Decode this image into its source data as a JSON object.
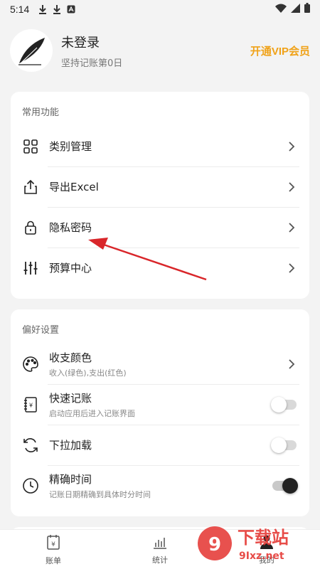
{
  "status_bar": {
    "time": "5:14"
  },
  "profile": {
    "name": "未登录",
    "subtitle": "坚持记账第0日",
    "vip_label": "开通VIP会员"
  },
  "common": {
    "title": "常用功能",
    "items": [
      {
        "label": "类别管理",
        "icon": "grid-icon"
      },
      {
        "label": "导出Excel",
        "icon": "share-icon"
      },
      {
        "label": "隐私密码",
        "icon": "lock-icon"
      },
      {
        "label": "预算中心",
        "icon": "sliders-icon"
      }
    ]
  },
  "prefs": {
    "title": "偏好设置",
    "items": [
      {
        "label": "收支颜色",
        "desc": "收入(绿色),支出(红色)",
        "control": "chevron"
      },
      {
        "label": "快速记账",
        "desc": "启动应用后进入记账界面",
        "control": "toggle",
        "on": false
      },
      {
        "label": "下拉加载",
        "desc": "",
        "control": "toggle",
        "on": false
      },
      {
        "label": "精确时间",
        "desc": "记账日期精确到具体时分时间",
        "control": "toggle",
        "on": true
      }
    ]
  },
  "bottom_nav": {
    "items": [
      {
        "label": "账单"
      },
      {
        "label": "统计"
      },
      {
        "label": "我的"
      }
    ]
  },
  "watermark": {
    "text": "下载站",
    "url": "9Ixz.net"
  },
  "colors": {
    "accent": "#f0a218",
    "arrow": "#d9262a"
  }
}
